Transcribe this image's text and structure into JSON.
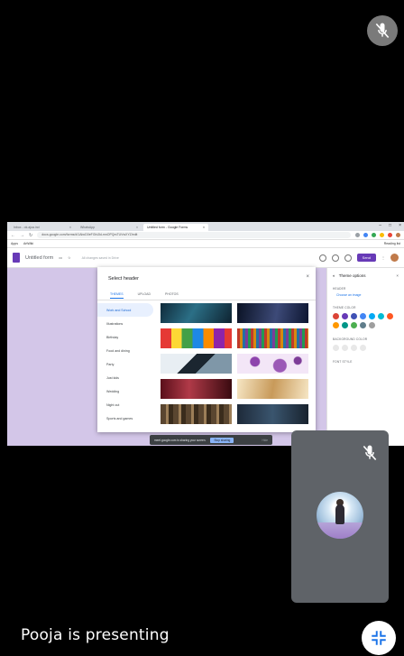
{
  "meeting": {
    "presenter_label": "Pooja is presenting"
  },
  "icons": {
    "mic_off_top": "mic-off-icon",
    "mic_off_self": "mic-off-icon",
    "minimize": "minimize-icon"
  },
  "shared_screen": {
    "browser": {
      "tabs": [
        {
          "label": "Inbox - ok.ajoa.ind",
          "active": false
        },
        {
          "label": "WhatsApp",
          "active": false
        },
        {
          "label": "Untitled form - Google Forms",
          "active": true
        }
      ],
      "url": "docs.google.com/forms/d/1AbcD0eFGhIJkLmnOPQrsTUVwXYZ/edit",
      "bookmarks": [
        "Apps",
        "ArtWiki"
      ],
      "bookmarks_right": "Reading list"
    },
    "forms": {
      "title": "Untitled form",
      "saved_status": "All changes saved in Drive",
      "send_label": "Send"
    },
    "dialog": {
      "title": "Select header",
      "close": "×",
      "tabs": [
        "THEMES",
        "UPLOAD",
        "PHOTOS"
      ],
      "categories": [
        "Work and School",
        "Illustrations",
        "Birthday",
        "Food and dining",
        "Party",
        "Just kids",
        "Wedding",
        "Night out",
        "Sports and games"
      ],
      "selected_category": "Work and School"
    },
    "theme_panel": {
      "title": "Theme options",
      "header_label": "HEADER",
      "choose_image": "Choose an image",
      "color_label": "THEME COLOR",
      "bg_label": "BACKGROUND COLOR",
      "font_label": "FONT STYLE",
      "colors": [
        "#db4437",
        "#673ab7",
        "#3f51b5",
        "#4285f4",
        "#03a9f4",
        "#00bcd4",
        "#ff5722",
        "#ff9800",
        "#009688",
        "#4caf50",
        "#607d8b",
        "#9e9e9e"
      ]
    },
    "share_banner": {
      "text": "meet.google.com is sharing your screen.",
      "stop": "Stop sharing",
      "hide": "Hide"
    }
  }
}
